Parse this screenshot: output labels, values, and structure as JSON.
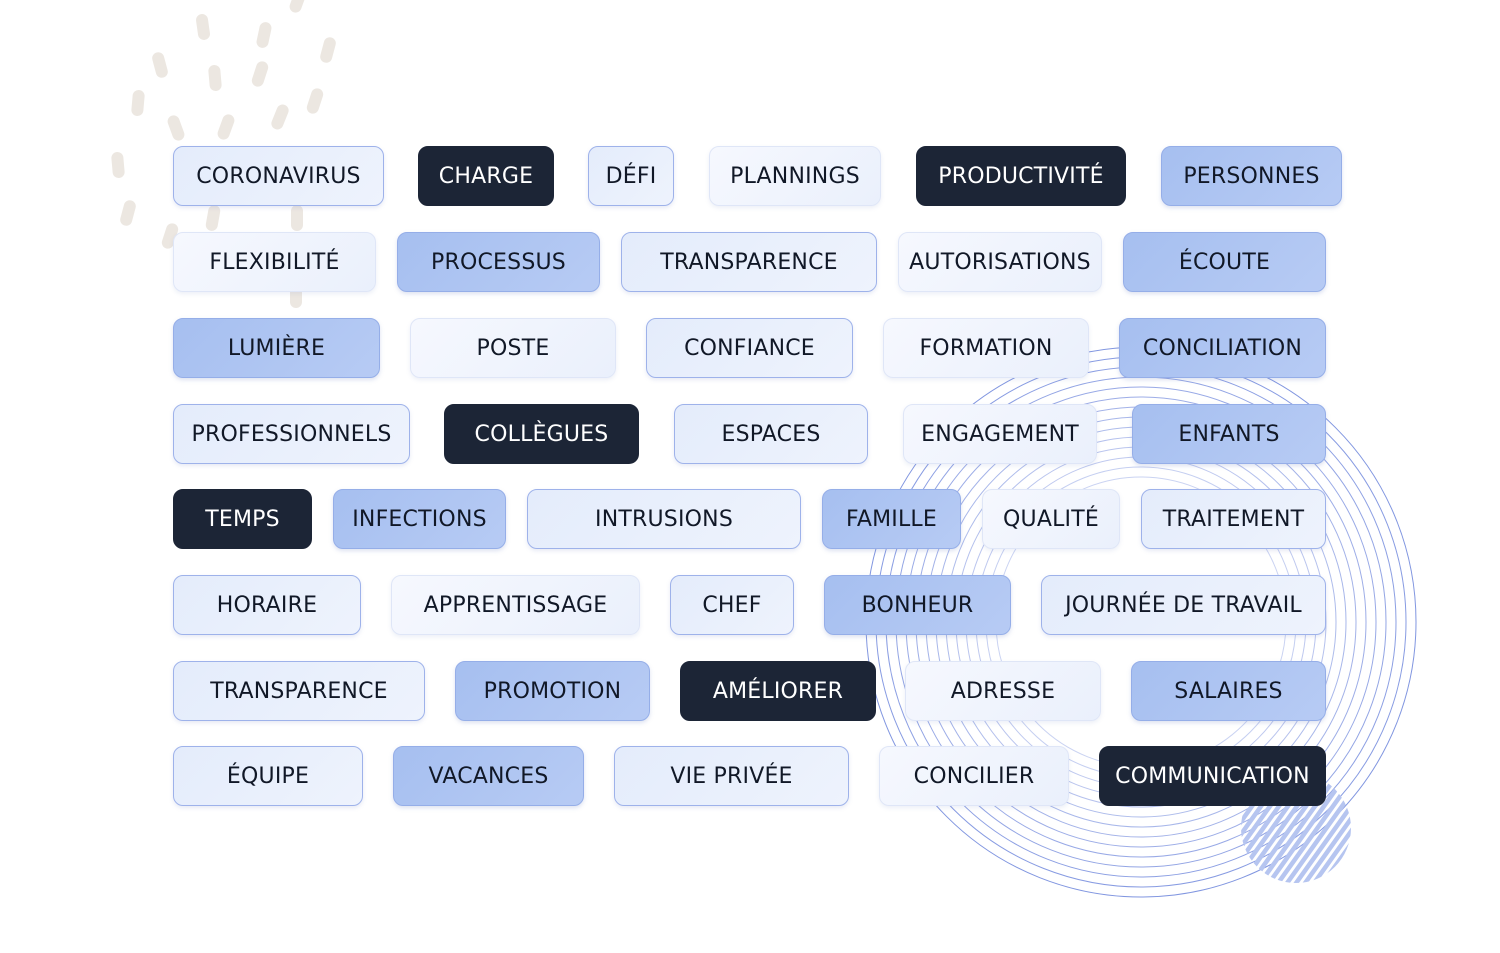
{
  "colors": {
    "dark": "#1c2536",
    "mid": "#aac2f1",
    "outline_border": "#9eb2ea",
    "light": "#f1f5fd",
    "rings": "#7f95e0",
    "dashes": "#ece7e1"
  },
  "tags": [
    {
      "label": "CORONAVIRUS",
      "style": "outline"
    },
    {
      "label": "CHARGE",
      "style": "dark"
    },
    {
      "label": "DÉFI",
      "style": "outline"
    },
    {
      "label": "PLANNINGS",
      "style": "light"
    },
    {
      "label": "PRODUCTIVITÉ",
      "style": "dark"
    },
    {
      "label": "PERSONNES",
      "style": "mid"
    },
    {
      "label": "FLEXIBILITÉ",
      "style": "light"
    },
    {
      "label": "PROCESSUS",
      "style": "mid"
    },
    {
      "label": "TRANSPARENCE",
      "style": "outline"
    },
    {
      "label": "AUTORISATIONS",
      "style": "light"
    },
    {
      "label": "ÉCOUTE",
      "style": "mid"
    },
    {
      "label": "LUMIÈRE",
      "style": "mid"
    },
    {
      "label": "POSTE",
      "style": "light"
    },
    {
      "label": "CONFIANCE",
      "style": "outline"
    },
    {
      "label": "FORMATION",
      "style": "light"
    },
    {
      "label": "CONCILIATION",
      "style": "mid"
    },
    {
      "label": "PROFESSIONNELS",
      "style": "outline"
    },
    {
      "label": "COLLÈGUES",
      "style": "dark"
    },
    {
      "label": "ESPACES",
      "style": "outline"
    },
    {
      "label": "ENGAGEMENT",
      "style": "light"
    },
    {
      "label": "ENFANTS",
      "style": "mid"
    },
    {
      "label": "TEMPS",
      "style": "dark"
    },
    {
      "label": "INFECTIONS",
      "style": "mid"
    },
    {
      "label": "INTRUSIONS",
      "style": "outline"
    },
    {
      "label": "FAMILLE",
      "style": "mid"
    },
    {
      "label": "QUALITÉ",
      "style": "light"
    },
    {
      "label": "TRAITEMENT",
      "style": "outline"
    },
    {
      "label": "HORAIRE",
      "style": "outline"
    },
    {
      "label": "APPRENTISSAGE",
      "style": "light"
    },
    {
      "label": "CHEF",
      "style": "outline"
    },
    {
      "label": "BONHEUR",
      "style": "mid"
    },
    {
      "label": "JOURNÉE DE TRAVAIL",
      "style": "outline"
    },
    {
      "label": "TRANSPARENCE",
      "style": "outline"
    },
    {
      "label": "PROMOTION",
      "style": "mid"
    },
    {
      "label": "AMÉLIORER",
      "style": "dark"
    },
    {
      "label": "ADRESSE",
      "style": "light"
    },
    {
      "label": "SALAIRES",
      "style": "mid"
    },
    {
      "label": "ÉQUIPE",
      "style": "outline"
    },
    {
      "label": "VACANCES",
      "style": "mid"
    },
    {
      "label": "VIE PRIVÉE",
      "style": "outline"
    },
    {
      "label": "CONCILIER",
      "style": "light"
    },
    {
      "label": "COMMUNICATION",
      "style": "dark"
    }
  ]
}
